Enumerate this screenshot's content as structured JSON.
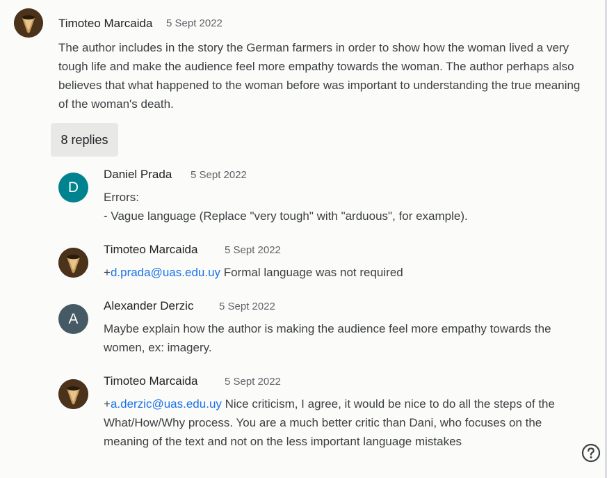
{
  "main_comment": {
    "author": "Timoteo Marcaida",
    "date": "5 Sept 2022",
    "text": "The author includes in the story the German farmers in order to show how the woman lived a very tough life and make the audience feel more empathy towards the woman. The author perhaps also believes that what happened to the woman before was important to understanding the true meaning of the woman's death."
  },
  "replies_button": {
    "label": "8 replies"
  },
  "replies": [
    {
      "author": "Daniel Prada",
      "date": "5 Sept 2022",
      "avatar_letter": "D",
      "avatar_color": "#00838f",
      "line1": "Errors:",
      "line2": "- Vague language (Replace \"very tough\" with \"arduous\", for example)."
    },
    {
      "author": "Timoteo Marcaida",
      "date": "5 Sept 2022",
      "prefix": "+",
      "mention": "d.prada@uas.edu.uy",
      "text": " Formal language was not required"
    },
    {
      "author": "Alexander Derzic",
      "date": "5 Sept 2022",
      "avatar_letter": "A",
      "avatar_color": "#455a64",
      "text": "Maybe explain how the author is making the audience feel more empathy towards the women, ex: imagery."
    },
    {
      "author": "Timoteo Marcaida",
      "date": "5 Sept 2022",
      "prefix": "+",
      "mention": "a.derzic@uas.edu.uy",
      "text": " Nice criticism, I agree, it would be nice to do all the steps of the What/How/Why process. You are a much better critic than Dani, who focuses on the meaning of the text and not on the less important language mistakes"
    }
  ],
  "icons": {
    "help": "help-circle-icon",
    "photo_avatar": "avatar-photo"
  },
  "colors": {
    "link": "#1a73e8",
    "replies_bg": "#e8e8e6"
  }
}
